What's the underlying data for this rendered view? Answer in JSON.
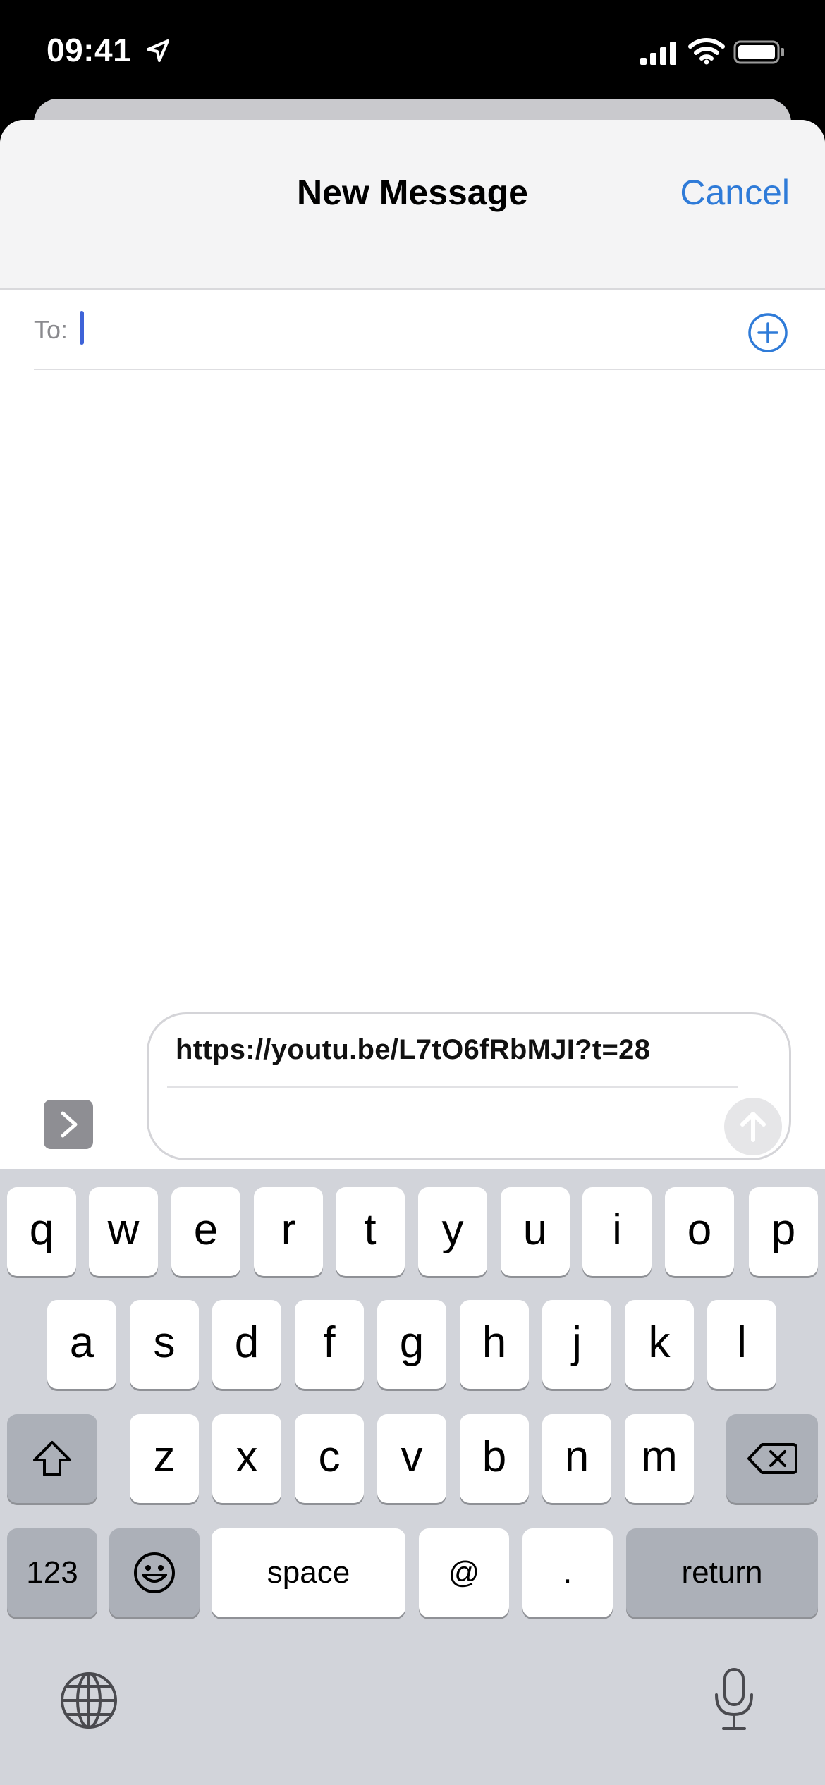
{
  "status_bar": {
    "time": "09:41"
  },
  "header": {
    "title": "New Message",
    "cancel_label": "Cancel"
  },
  "to_field": {
    "label": "To:",
    "value": ""
  },
  "compose": {
    "text": "https://youtu.be/L7tO6fRbMJI?t=28"
  },
  "keyboard": {
    "row1": [
      "q",
      "w",
      "e",
      "r",
      "t",
      "y",
      "u",
      "i",
      "o",
      "p"
    ],
    "row2": [
      "a",
      "s",
      "d",
      "f",
      "g",
      "h",
      "j",
      "k",
      "l"
    ],
    "row3": [
      "z",
      "x",
      "c",
      "v",
      "b",
      "n",
      "m"
    ],
    "numbers_label": "123",
    "space_label": "space",
    "at_label": "@",
    "period_label": ".",
    "return_label": "return"
  },
  "icons": [
    "location-arrow-icon",
    "cellular-signal-icon",
    "wifi-icon",
    "battery-icon",
    "add-contact-icon",
    "chevron-right-icon",
    "send-arrow-icon",
    "shift-icon",
    "delete-icon",
    "emoji-icon",
    "globe-icon",
    "microphone-icon"
  ],
  "colors": {
    "accent": "#2f7bd8",
    "keyboard_bg": "#d2d4da",
    "caret": "#3e63d8"
  }
}
